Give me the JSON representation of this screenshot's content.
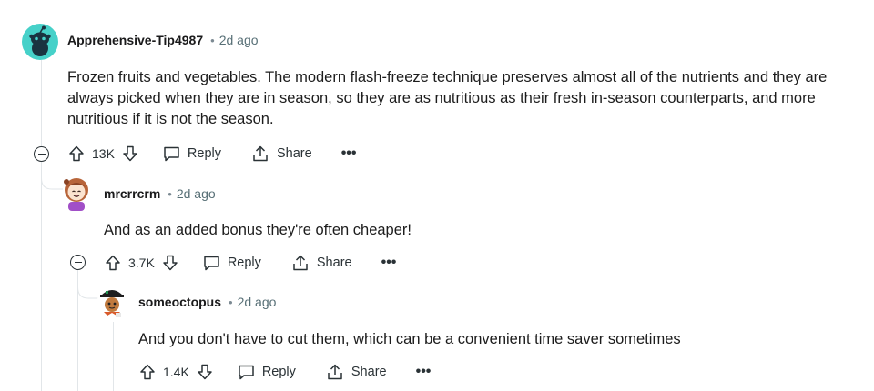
{
  "comments": [
    {
      "author": "Apprehensive-Tip4987",
      "separator": "•",
      "time": "2d ago",
      "body_lines": [
        "Frozen fruits and vegetables. The modern flash-freeze technique preserves almost all of the nutrients and they are",
        "always picked when they are in season, so they are as nutritious as their fresh in-season counterparts, and more",
        "nutritious if it is not the season."
      ],
      "score": "13K",
      "reply_label": "Reply",
      "share_label": "Share",
      "more_label": "•••"
    },
    {
      "author": "mrcrrcrm",
      "separator": "•",
      "time": "2d ago",
      "body_lines": [
        "And as an added bonus they're often cheaper!"
      ],
      "score": "3.7K",
      "reply_label": "Reply",
      "share_label": "Share",
      "more_label": "•••"
    },
    {
      "author": "someoctopus",
      "separator": "•",
      "time": "2d ago",
      "body_lines": [
        "And you don't have to cut them, which can be a convenient time saver sometimes"
      ],
      "score": "1.4K",
      "reply_label": "Reply",
      "share_label": "Share",
      "more_label": "•••"
    }
  ],
  "colors": {
    "thread_line": "#e2e6e9",
    "meta_text": "#576f76",
    "avatar_teal": "#46d1c9"
  },
  "icons": [
    "snoo-avatar-icon",
    "upvote-icon",
    "downvote-icon",
    "reply-bubble-icon",
    "share-icon",
    "collapse-icon",
    "more-icon"
  ]
}
